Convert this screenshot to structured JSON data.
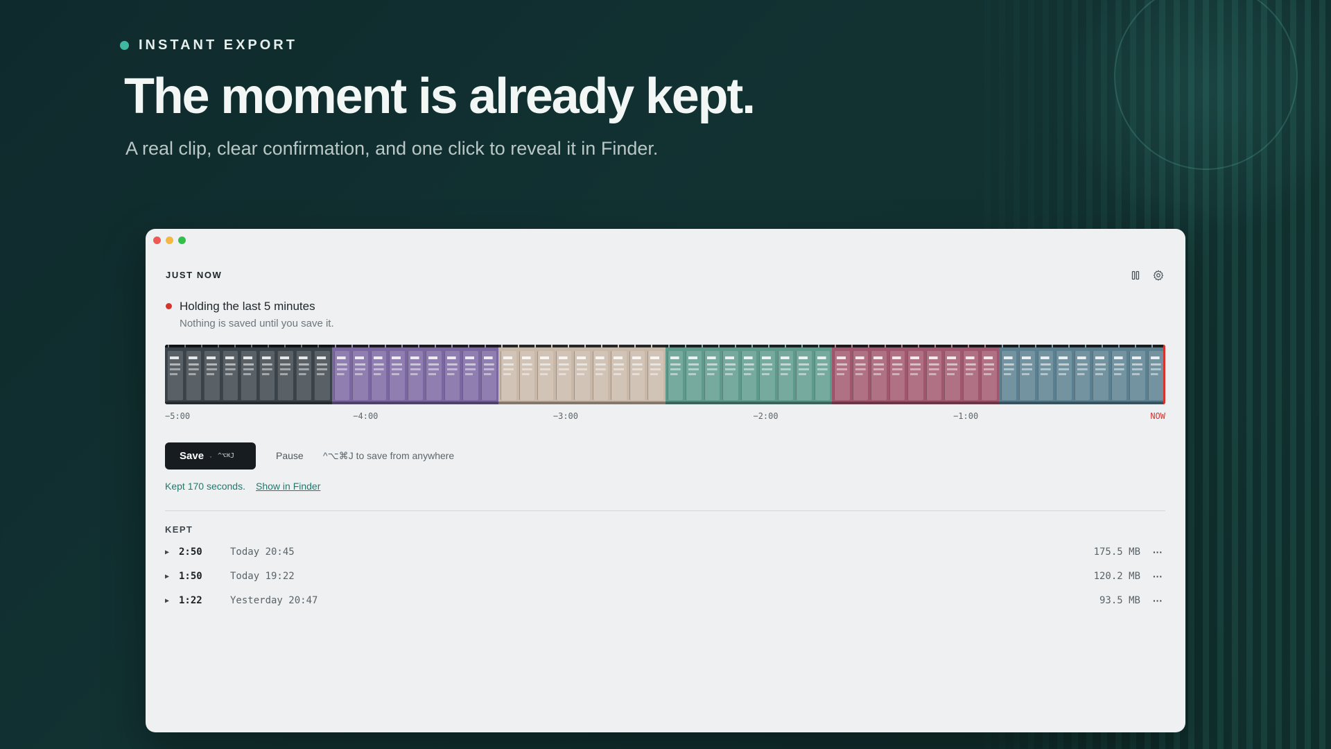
{
  "hero": {
    "eyebrow": "INSTANT EXPORT",
    "headline": "The moment is already kept.",
    "subhead": "A real clip, clear confirmation, and one click to reveal it in Finder."
  },
  "window": {
    "section_title": "JUST NOW",
    "status": {
      "title": "Holding the last 5 minutes",
      "subtitle": "Nothing is saved until you save it."
    },
    "timeline": {
      "segments": [
        {
          "color": "#3a4349",
          "frames": 9
        },
        {
          "color": "#7a66a0",
          "frames": 9
        },
        {
          "color": "#c9b8a8",
          "frames": 9
        },
        {
          "color": "#5e9a8c",
          "frames": 9
        },
        {
          "color": "#a0566c",
          "frames": 9
        },
        {
          "color": "#5a7f90",
          "frames": 9
        }
      ],
      "ticks": [
        "−5:00",
        "−4:00",
        "−3:00",
        "−2:00",
        "−1:00",
        "NOW"
      ],
      "accent_color": "#d8342e"
    },
    "actions": {
      "save_label": "Save",
      "save_separator": "·",
      "save_shortcut": "^⌥⌘J",
      "pause_label": "Pause",
      "hint": "^⌥⌘J to save from anywhere"
    },
    "confirmation": {
      "message": "Kept 170 seconds.",
      "link": "Show in Finder"
    },
    "kept": {
      "title": "KEPT",
      "items": [
        {
          "duration": "2:50",
          "when": "Today 20:45",
          "size": "175.5 MB"
        },
        {
          "duration": "1:50",
          "when": "Today 19:22",
          "size": "120.2 MB"
        },
        {
          "duration": "1:22",
          "when": "Yesterday 20:47",
          "size": "93.5 MB"
        }
      ]
    }
  }
}
